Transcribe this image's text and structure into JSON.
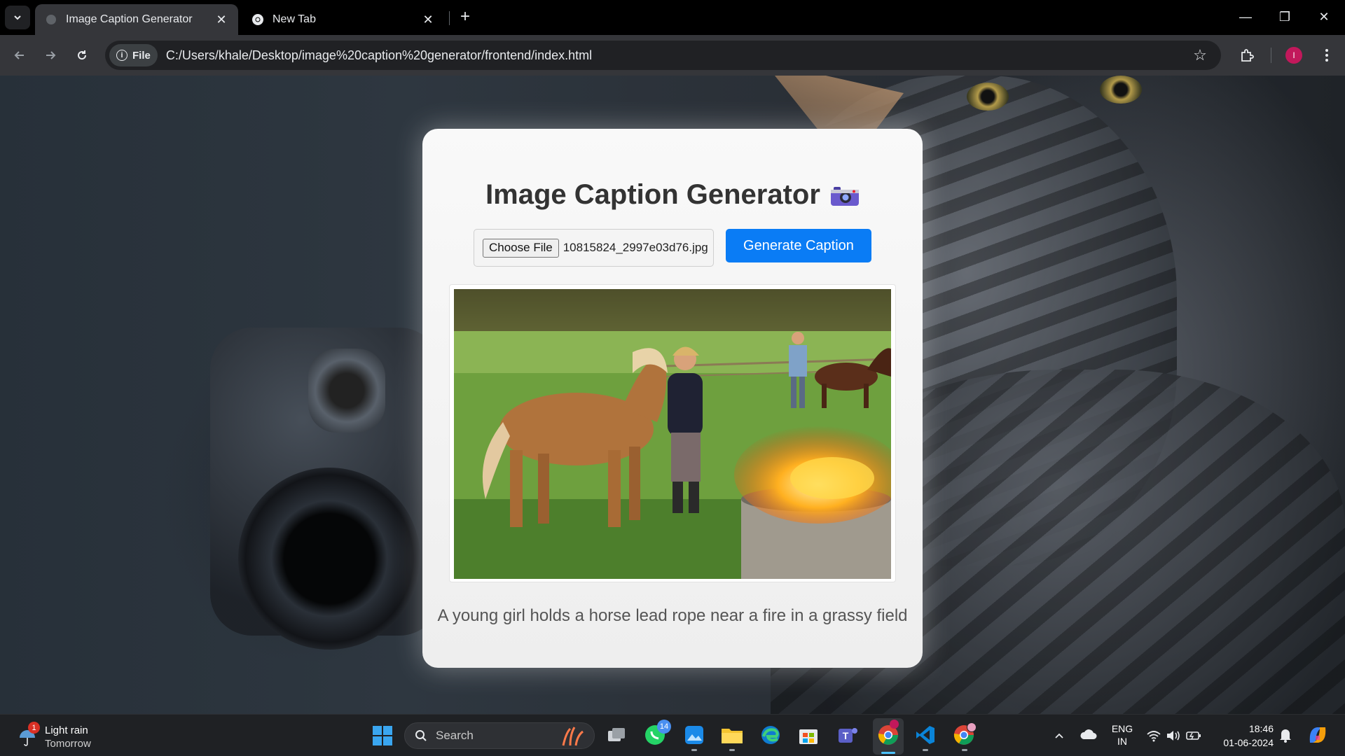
{
  "browser": {
    "tabs": [
      {
        "title": "Image Caption Generator",
        "active": true
      },
      {
        "title": "New Tab",
        "active": false
      }
    ],
    "site_chip": "File",
    "url": "C:/Users/khale/Desktop/image%20caption%20generator/frontend/index.html",
    "profile_initial": "I"
  },
  "page": {
    "title": "Image Caption Generator",
    "title_emoji": "📷",
    "choose_file_label": "Choose File",
    "file_name": "10815824_2997e03d76.jpg",
    "generate_label": "Generate Caption",
    "caption": "A young girl holds a horse lead rope near a fire in a grassy field",
    "accent_color": "#0a7cf5"
  },
  "taskbar": {
    "weather_title": "Light rain",
    "weather_sub": "Tomorrow",
    "weather_badge": "1",
    "search_placeholder": "Search",
    "whatsapp_badge": "14",
    "lang_line1": "ENG",
    "lang_line2": "IN",
    "time": "18:46",
    "date": "01-06-2024"
  }
}
